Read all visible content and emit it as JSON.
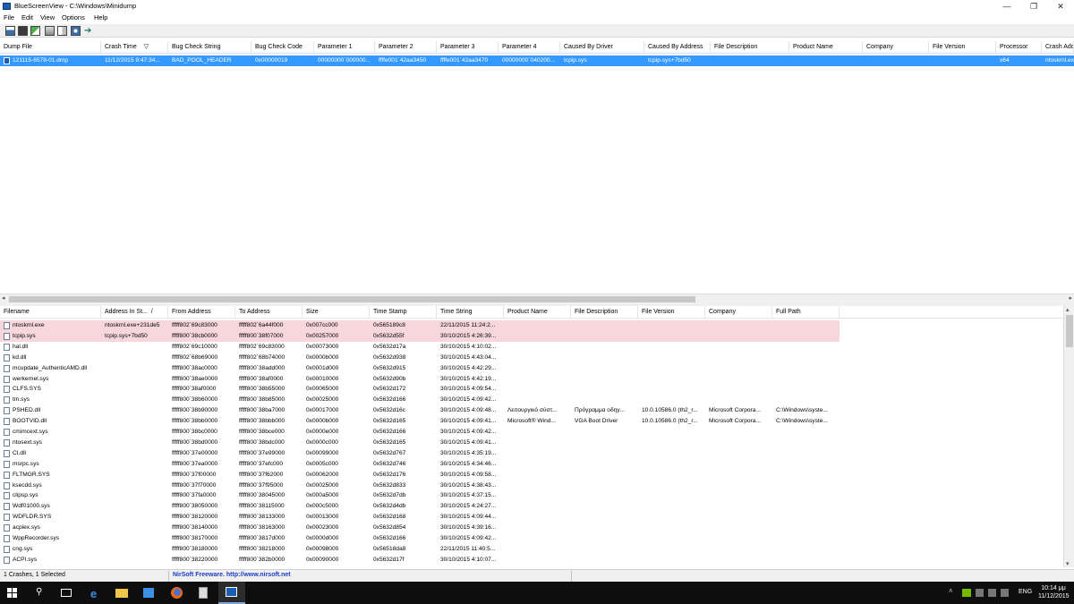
{
  "window": {
    "title": "BlueScreenView  -  C:\\Windows\\Minidump"
  },
  "titlebar_buttons": {
    "minimize": "—",
    "maximize": "❐",
    "close": "✕"
  },
  "menu": [
    "File",
    "Edit",
    "View",
    "Options",
    "Help"
  ],
  "toolbar_icons": [
    "save-icon",
    "disk-icon",
    "refresh-icon",
    "copy-icon",
    "properties-icon",
    "find-icon",
    "exit-icon"
  ],
  "upper_columns": [
    "Dump File",
    "Crash Time",
    "Bug Check String",
    "Bug Check Code",
    "Parameter 1",
    "Parameter 2",
    "Parameter 3",
    "Parameter 4",
    "Caused By Driver",
    "Caused By Address",
    "File Description",
    "Product Name",
    "Company",
    "File Version",
    "Processor",
    "Crash Add"
  ],
  "sort_indicator": "▽",
  "upper_rows": [
    [
      "121115-6578-01.dmp",
      "11/12/2015 9:47:34...",
      "BAD_POOL_HEADER",
      "0x00000019",
      "00000000`000000...",
      "ffffe001`42aa3450",
      "ffffe001`42aa3470",
      "00000000`040200...",
      "tcpip.sys",
      "tcpip.sys+7bd50",
      "",
      "",
      "",
      "",
      "x64",
      "ntoskrnl.ex"
    ]
  ],
  "lower_columns": [
    "Filename",
    "Address In St...",
    "From Address",
    "To Address",
    "Size",
    "Time Stamp",
    "Time String",
    "Product Name",
    "File Description",
    "File Version",
    "Company",
    "Full Path"
  ],
  "lower_rows": [
    [
      "ntoskrnl.exe",
      "ntoskrnl.exe+231de5",
      "fffff802`69c83000",
      "fffff802`6a44f000",
      "0x007cc000",
      "0x565189c8",
      "22/11/2015 11:24:2...",
      "",
      "",
      "",
      "",
      ""
    ],
    [
      "tcpip.sys",
      "tcpip.sys+7bd50",
      "fffff800`38cb0000",
      "fffff800`38f07000",
      "0x00257000",
      "0x5632d55f",
      "30/10/2015 4:26:39...",
      "",
      "",
      "",
      "",
      ""
    ],
    [
      "hal.dll",
      "",
      "fffff802`69c10000",
      "fffff802`69c83000",
      "0x00073000",
      "0x5632d17a",
      "30/10/2015 4:10:02...",
      "",
      "",
      "",
      "",
      ""
    ],
    [
      "kd.dll",
      "",
      "fffff802`68b69000",
      "fffff802`68b74000",
      "0x0000b000",
      "0x5632d938",
      "30/10/2015 4:43:04...",
      "",
      "",
      "",
      "",
      ""
    ],
    [
      "mcupdate_AuthenticAMD.dll",
      "",
      "fffff800`38ac0000",
      "fffff800`38add000",
      "0x0001d000",
      "0x5632d915",
      "30/10/2015 4:42:29...",
      "",
      "",
      "",
      "",
      ""
    ],
    [
      "werkernel.sys",
      "",
      "fffff800`38ae0000",
      "fffff800`38af0000",
      "0x00010000",
      "0x5632d90b",
      "30/10/2015 4:42:19...",
      "",
      "",
      "",
      "",
      ""
    ],
    [
      "CLFS.SYS",
      "",
      "fffff800`38af0000",
      "fffff800`38b55000",
      "0x00065000",
      "0x5632d172",
      "30/10/2015 4:09:54...",
      "",
      "",
      "",
      "",
      ""
    ],
    [
      "tm.sys",
      "",
      "fffff800`38b60000",
      "fffff800`38b85000",
      "0x00025000",
      "0x5632d166",
      "30/10/2015 4:09:42...",
      "",
      "",
      "",
      "",
      ""
    ],
    [
      "PSHED.dll",
      "",
      "fffff800`38b90000",
      "fffff800`38ba7000",
      "0x00017000",
      "0x5632d16c",
      "30/10/2015 4:09:48...",
      "Λειτουργικό σύστ...",
      "Πρόγραμμα οδηγ...",
      "10.0.10586.0 (th2_r...",
      "Microsoft Corpora...",
      "C:\\Windows\\syste..."
    ],
    [
      "BOOTVID.dll",
      "",
      "fffff800`38bb0000",
      "fffff800`38bbb000",
      "0x0000b000",
      "0x5632d165",
      "30/10/2015 4:09:41...",
      "Microsoft® Wind...",
      "VGA Boot Driver",
      "10.0.10586.0 (th2_r...",
      "Microsoft Corpora...",
      "C:\\Windows\\syste..."
    ],
    [
      "cmimcext.sys",
      "",
      "fffff800`38bc0000",
      "fffff800`38bce000",
      "0x0000e000",
      "0x5632d166",
      "30/10/2015 4:09:42...",
      "",
      "",
      "",
      "",
      ""
    ],
    [
      "ntosext.sys",
      "",
      "fffff800`38bd0000",
      "fffff800`38bdc000",
      "0x0000c000",
      "0x5632d165",
      "30/10/2015 4:09:41...",
      "",
      "",
      "",
      "",
      ""
    ],
    [
      "CI.dll",
      "",
      "fffff800`37e00000",
      "fffff800`37e99000",
      "0x00099000",
      "0x5632d767",
      "30/10/2015 4:35:19...",
      "",
      "",
      "",
      "",
      ""
    ],
    [
      "msrpc.sys",
      "",
      "fffff800`37ea0000",
      "fffff800`37efc000",
      "0x0005c000",
      "0x5632d746",
      "30/10/2015 4:34:46...",
      "",
      "",
      "",
      "",
      ""
    ],
    [
      "FLTMGR.SYS",
      "",
      "fffff800`37f00000",
      "fffff800`37f62000",
      "0x00062000",
      "0x5632d176",
      "30/10/2015 4:09:58...",
      "",
      "",
      "",
      "",
      ""
    ],
    [
      "ksecdd.sys",
      "",
      "fffff800`37f70000",
      "fffff800`37f95000",
      "0x00025000",
      "0x5632d833",
      "30/10/2015 4:38:43...",
      "",
      "",
      "",
      "",
      ""
    ],
    [
      "clipsp.sys",
      "",
      "fffff800`37fa0000",
      "fffff800`38045000",
      "0x000a5000",
      "0x5632d7db",
      "30/10/2015 4:37:15...",
      "",
      "",
      "",
      "",
      ""
    ],
    [
      "Wdf01000.sys",
      "",
      "fffff800`38050000",
      "fffff800`38115000",
      "0x000c5000",
      "0x5632d4db",
      "30/10/2015 4:24:27...",
      "",
      "",
      "",
      "",
      ""
    ],
    [
      "WDFLDR.SYS",
      "",
      "fffff800`38120000",
      "fffff800`38133000",
      "0x00013000",
      "0x5632d168",
      "30/10/2015 4:09:44...",
      "",
      "",
      "",
      "",
      ""
    ],
    [
      "acpiex.sys",
      "",
      "fffff800`38140000",
      "fffff800`38163000",
      "0x00023000",
      "0x5632d854",
      "30/10/2015 4:39:16...",
      "",
      "",
      "",
      "",
      ""
    ],
    [
      "WppRecorder.sys",
      "",
      "fffff800`38170000",
      "fffff800`3817d000",
      "0x0000d000",
      "0x5632d166",
      "30/10/2015 4:09:42...",
      "",
      "",
      "",
      "",
      ""
    ],
    [
      "cng.sys",
      "",
      "fffff800`38180000",
      "fffff800`38218000",
      "0x00098000",
      "0x56518da8",
      "22/11/2015 11:40:5...",
      "",
      "",
      "",
      "",
      ""
    ],
    [
      "ACPI.sys",
      "",
      "fffff800`38220000",
      "fffff800`382b0000",
      "0x00090000",
      "0x5632d17f",
      "30/10/2015 4:10:07...",
      "",
      "",
      "",
      "",
      ""
    ]
  ],
  "status": {
    "summary": "1 Crashes, 1 Selected",
    "credit": "NirSoft Freeware.  http://www.nirsoft.net"
  },
  "scroll": {
    "left": "◂",
    "right": "▸",
    "up": "▴",
    "down": "▾"
  },
  "taskbar": {
    "search_glyph": "⚲",
    "edge_glyph": "e",
    "tray_up": "˄",
    "language": "ENG",
    "time": "10:14 μμ",
    "date": "11/12/2015"
  },
  "colors": {
    "selected_row": "#3399ff",
    "highlight_row": "#f8d7dc",
    "taskbar": "#0e0e0e",
    "link": "#1a3cc8"
  }
}
